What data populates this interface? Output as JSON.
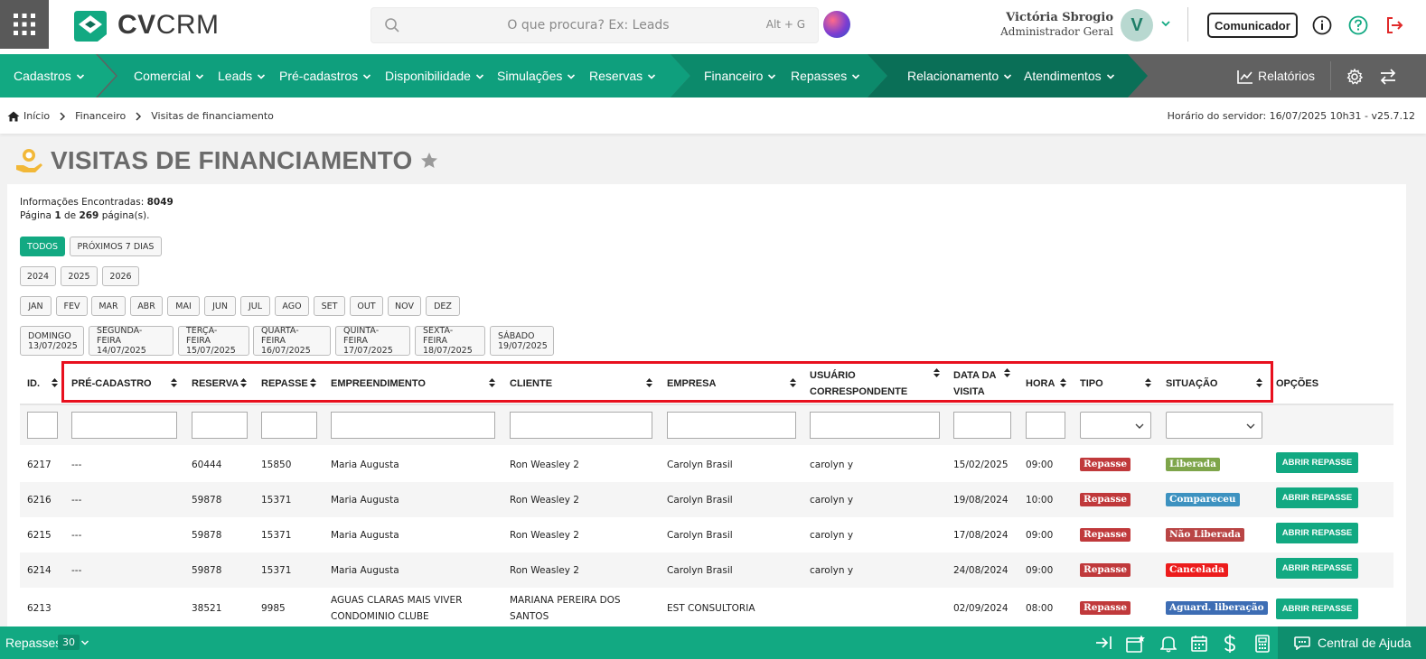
{
  "app": {
    "logo_bold": "CV",
    "logo_thin": "CRM"
  },
  "search": {
    "placeholder": "O que procura? Ex: Leads",
    "shortcut": "Alt + G"
  },
  "user": {
    "name": "Victória Sbrogio",
    "role": "Administrador Geral",
    "initial": "V"
  },
  "top_actions": {
    "communicator": "Comunicador"
  },
  "nav": {
    "cadastros": "Cadastros",
    "comercial": "Comercial",
    "leads": "Leads",
    "precadastros": "Pré-cadastros",
    "disponibilidade": "Disponibilidade",
    "simulacoes": "Simulações",
    "reservas": "Reservas",
    "financeiro": "Financeiro",
    "repasses": "Repasses",
    "relacionamento": "Relacionamento",
    "atendimentos": "Atendimentos",
    "relatorios": "Relatórios"
  },
  "breadcrumb": [
    "Início",
    "Financeiro",
    "Visitas de financiamento"
  ],
  "server_time": "Horário do servidor: 16/07/2025 10h31 - v25.7.12",
  "page_title": "VISITAS DE FINANCIAMENTO",
  "info": {
    "found_label": "Informações Encontradas:",
    "found_count": "8049",
    "page_label": "Página",
    "page_current": "1",
    "page_of": "de",
    "page_total": "269",
    "page_suffix": "página(s)."
  },
  "filters": {
    "period": [
      "TODOS",
      "PRÓXIMOS 7 DIAS"
    ],
    "years": [
      "2024",
      "2025",
      "2026"
    ],
    "months": [
      "JAN",
      "FEV",
      "MAR",
      "ABR",
      "MAI",
      "JUN",
      "JUL",
      "AGO",
      "SET",
      "OUT",
      "NOV",
      "DEZ"
    ],
    "days": [
      {
        "name": "DOMINGO",
        "date": "13/07/2025"
      },
      {
        "name": "SEGUNDA-FEIRA",
        "date": "14/07/2025"
      },
      {
        "name": "TERÇA-FEIRA",
        "date": "15/07/2025"
      },
      {
        "name": "QUARTA-FEIRA",
        "date": "16/07/2025"
      },
      {
        "name": "QUINTA-FEIRA",
        "date": "17/07/2025"
      },
      {
        "name": "SEXTA-FEIRA",
        "date": "18/07/2025"
      },
      {
        "name": "SÁBADO",
        "date": "19/07/2025"
      }
    ]
  },
  "table": {
    "headers": {
      "id": "ID.",
      "precadastro": "PRÉ-CADASTRO",
      "reserva": "RESERVA",
      "repasse": "REPASSE",
      "empreendimento": "EMPREENDIMENTO",
      "cliente": "CLIENTE",
      "empresa": "EMPRESA",
      "usuario_l1": "USUÁRIO",
      "usuario_l2": "CORRESPONDENTE",
      "data_l1": "DATA DA",
      "data_l2": "VISITA",
      "hora": "HORA",
      "tipo": "TIPO",
      "situacao": "SITUAÇÃO",
      "opcoes": "OPÇÕES"
    },
    "action_label": "ABRIR REPASSE",
    "rows": [
      {
        "id": "6217",
        "precadastro": "---",
        "reserva": "60444",
        "repasse": "15850",
        "empreendimento": "Maria Augusta",
        "cliente": "Ron Weasley 2",
        "empresa": "Carolyn Brasil",
        "usuario": "carolyn y",
        "data": "15/02/2025",
        "hora": "09:00",
        "tipo": "Repasse",
        "situacao": "Liberada",
        "situacao_color": "#7ea54a"
      },
      {
        "id": "6216",
        "precadastro": "---",
        "reserva": "59878",
        "repasse": "15371",
        "empreendimento": "Maria Augusta",
        "cliente": "Ron Weasley 2",
        "empresa": "Carolyn Brasil",
        "usuario": "carolyn y",
        "data": "19/08/2024",
        "hora": "10:00",
        "tipo": "Repasse",
        "situacao": "Compareceu",
        "situacao_color": "#3d92c0"
      },
      {
        "id": "6215",
        "precadastro": "---",
        "reserva": "59878",
        "repasse": "15371",
        "empreendimento": "Maria Augusta",
        "cliente": "Ron Weasley 2",
        "empresa": "Carolyn Brasil",
        "usuario": "carolyn y",
        "data": "17/08/2024",
        "hora": "09:00",
        "tipo": "Repasse",
        "situacao": "Não Liberada",
        "situacao_color": "#b94545"
      },
      {
        "id": "6214",
        "precadastro": "---",
        "reserva": "59878",
        "repasse": "15371",
        "empreendimento": "Maria Augusta",
        "cliente": "Ron Weasley 2",
        "empresa": "Carolyn Brasil",
        "usuario": "carolyn y",
        "data": "24/08/2024",
        "hora": "09:00",
        "tipo": "Repasse",
        "situacao": "Cancelada",
        "situacao_color": "#ec1c1c"
      },
      {
        "id": "6213",
        "precadastro": "",
        "reserva": "38521",
        "repasse": "9985",
        "empreendimento": "AGUAS CLARAS MAIS VIVER CONDOMINIO CLUBE",
        "cliente": "MARIANA PEREIRA DOS SANTOS",
        "empresa": "EST CONSULTORIA",
        "usuario": "",
        "data": "02/09/2024",
        "hora": "08:00",
        "tipo": "Repasse",
        "situacao": "Aguard. liberação",
        "situacao_color": "#3d6db4"
      }
    ]
  },
  "colors": {
    "accent": "#12a982",
    "tipo_badge": "#c0393b",
    "highlight": "#e8101e"
  },
  "footer": {
    "section": "Repasses",
    "count": "30",
    "help": "Central de Ajuda"
  }
}
